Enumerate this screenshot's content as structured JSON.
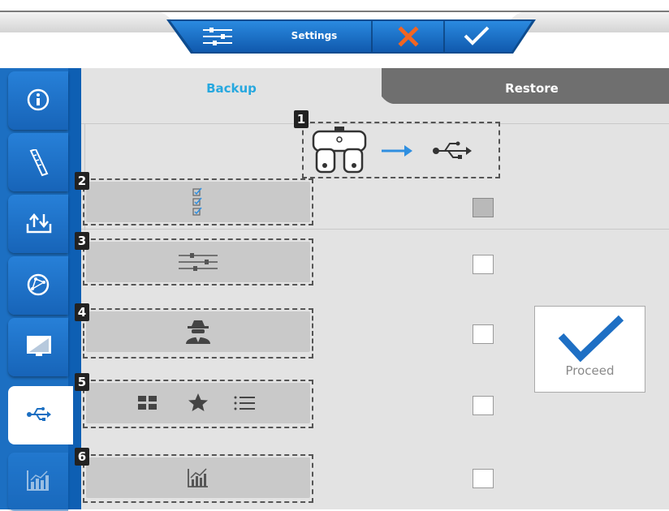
{
  "colors": {
    "accent_blue": "#1c6fc2",
    "tab_active_text": "#27a8df",
    "cancel_orange": "#f26522"
  },
  "toolbar": {
    "settings_label": "Settings",
    "icons": [
      "sliders-icon",
      "close-icon",
      "checkmark-icon"
    ]
  },
  "tabs": {
    "backup": "Backup",
    "restore": "Restore",
    "active": "Backup"
  },
  "sidebar": {
    "items": [
      {
        "icon": "info-icon",
        "active": false
      },
      {
        "icon": "ruler-icon",
        "active": false
      },
      {
        "icon": "upload-download-icon",
        "active": false
      },
      {
        "icon": "compass-icon",
        "active": false
      },
      {
        "icon": "monitor-icon",
        "active": false
      },
      {
        "icon": "usb-icon",
        "active": true
      },
      {
        "icon": "chart-icon",
        "active": false
      }
    ]
  },
  "header_step": {
    "number": "1",
    "icons": [
      "phoropter-icon",
      "arrow-right-icon",
      "usb-icon"
    ]
  },
  "rows": [
    {
      "number": "2",
      "icon": "checklist-icon",
      "checked": false,
      "disabled": true
    },
    {
      "number": "3",
      "icon": "sliders-icon",
      "checked": false,
      "disabled": false
    },
    {
      "number": "4",
      "icon": "spy-icon",
      "checked": false,
      "disabled": false
    },
    {
      "number": "5",
      "icon": "layout-favorites-list-icon",
      "checked": false,
      "disabled": false
    },
    {
      "number": "6",
      "icon": "chart-icon",
      "checked": false,
      "disabled": false
    }
  ],
  "proceed": {
    "label": "Proceed",
    "icon": "checkmark-icon"
  }
}
